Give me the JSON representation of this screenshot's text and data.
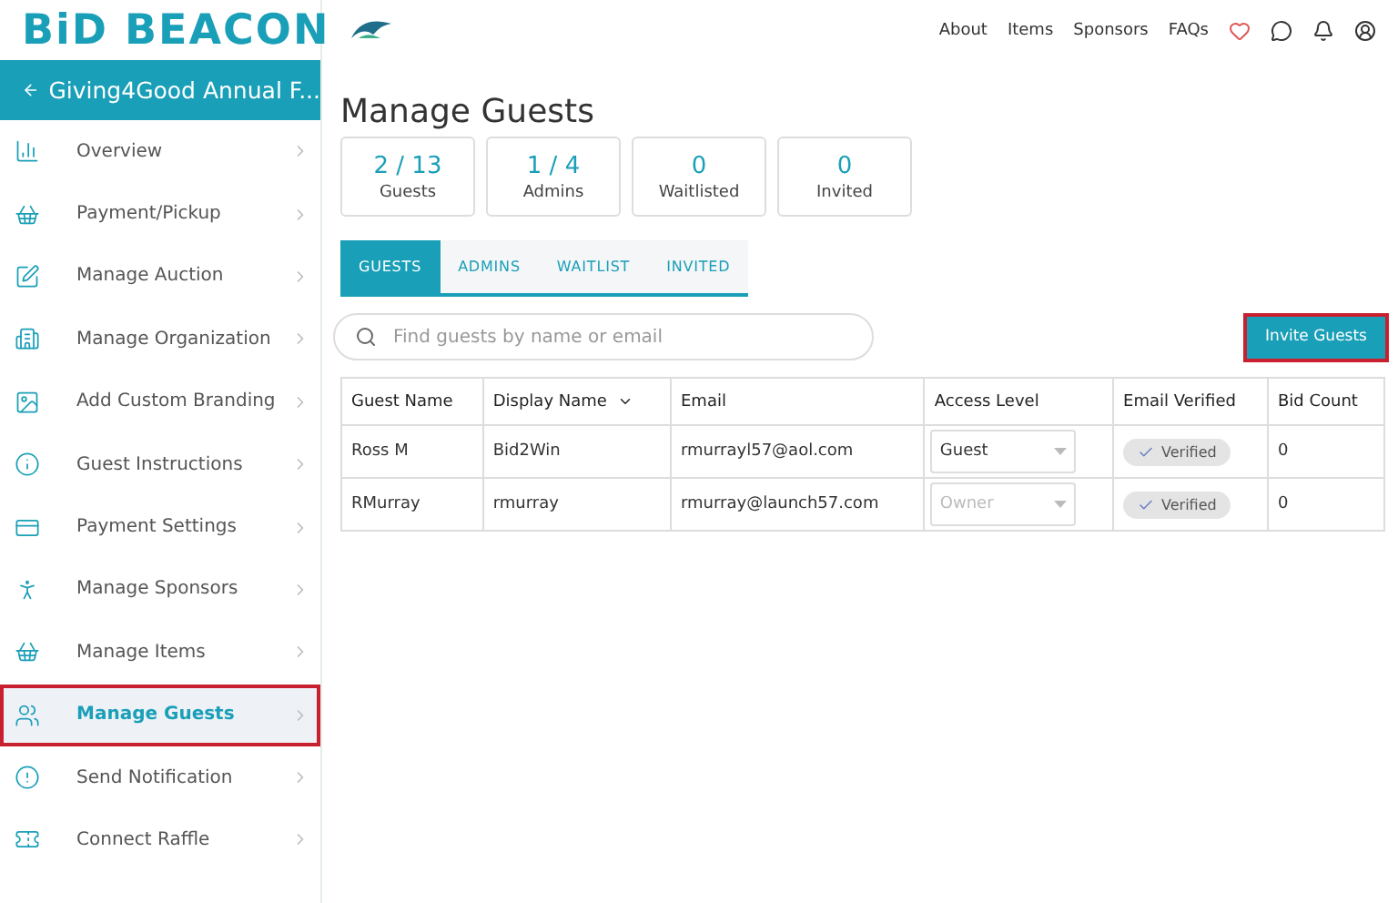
{
  "brand": {
    "logo": "BiD BEACON"
  },
  "nav": [
    {
      "label": "About"
    },
    {
      "label": "Items"
    },
    {
      "label": "Sponsors"
    },
    {
      "label": "FAQs"
    }
  ],
  "sidebar": {
    "back_title": "Giving4Good Annual F...",
    "items": [
      {
        "label": "Overview",
        "selected": false,
        "highlighted": false
      },
      {
        "label": "Payment/Pickup",
        "selected": false,
        "highlighted": false
      },
      {
        "label": "Manage Auction",
        "selected": false,
        "highlighted": false
      },
      {
        "label": "Manage Organization",
        "selected": false,
        "highlighted": false
      },
      {
        "label": "Add Custom Branding",
        "selected": false,
        "highlighted": false
      },
      {
        "label": "Guest Instructions",
        "selected": false,
        "highlighted": false
      },
      {
        "label": "Payment Settings",
        "selected": false,
        "highlighted": false
      },
      {
        "label": "Manage Sponsors",
        "selected": false,
        "highlighted": false
      },
      {
        "label": "Manage Items",
        "selected": false,
        "highlighted": false
      },
      {
        "label": "Manage Guests",
        "selected": true,
        "highlighted": true
      },
      {
        "label": "Send Notification",
        "selected": false,
        "highlighted": false
      },
      {
        "label": "Connect Raffle",
        "selected": false,
        "highlighted": false
      }
    ]
  },
  "page_title": "Manage Guests",
  "stats": [
    {
      "value": "2 / 13",
      "label": "Guests"
    },
    {
      "value": "1 / 4",
      "label": "Admins"
    },
    {
      "value": "0",
      "label": "Waitlisted"
    },
    {
      "value": "0",
      "label": "Invited"
    }
  ],
  "tabs": [
    {
      "label": "GUESTS",
      "selected": true
    },
    {
      "label": "ADMINS",
      "selected": false
    },
    {
      "label": "WAITLIST",
      "selected": false
    },
    {
      "label": "INVITED",
      "selected": false
    }
  ],
  "search": {
    "placeholder": "Find guests by name or email"
  },
  "invite_button": {
    "label": "Invite Guests",
    "highlighted": true
  },
  "table": {
    "columns": [
      {
        "label": "Guest Name",
        "sortable": false
      },
      {
        "label": "Display Name",
        "sortable": true
      },
      {
        "label": "Email",
        "sortable": false
      },
      {
        "label": "Access Level",
        "sortable": false
      },
      {
        "label": "Email Verified",
        "sortable": false
      },
      {
        "label": "Bid Count",
        "sortable": false
      }
    ],
    "rows": [
      {
        "guest_name": "Ross M",
        "display_name": "Bid2Win",
        "email": "rmurrayl57@aol.com",
        "access_level": "Guest",
        "access_disabled": false,
        "verified": "Verified",
        "bid_count": "0"
      },
      {
        "guest_name": "RMurray",
        "display_name": "rmurray",
        "email": "rmurray@launch57.com",
        "access_level": "Owner",
        "access_disabled": true,
        "verified": "Verified",
        "bid_count": "0"
      }
    ]
  }
}
